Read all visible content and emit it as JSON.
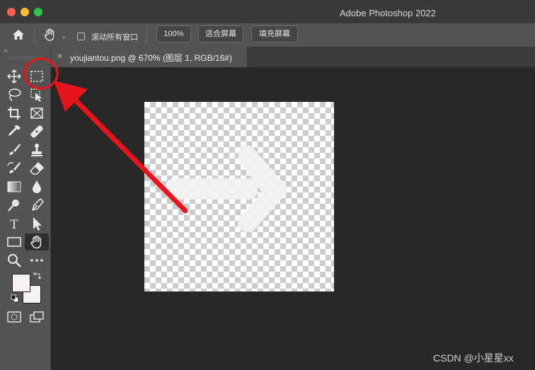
{
  "window": {
    "title": "Adobe Photoshop 2022"
  },
  "options": {
    "scroll_all_windows": "滚动所有窗口",
    "zoom_100": "100%",
    "fit_screen": "适合屏幕",
    "fill_screen": "填充屏幕"
  },
  "document_tab": {
    "close": "×",
    "title": "youjiantou.png @ 670% (图层 1, RGB/16#)"
  },
  "toolbar": {
    "collapse": "‹‹",
    "tools": [
      "move-icon",
      "rectangular-marquee-icon",
      "lasso-icon",
      "object-selection-icon",
      "crop-icon",
      "frame-icon",
      "eyedropper-icon",
      "healing-brush-icon",
      "brush-icon",
      "clone-stamp-icon",
      "history-brush-icon",
      "eraser-icon",
      "gradient-icon",
      "blur-icon",
      "dodge-icon",
      "pen-icon",
      "type-icon",
      "path-selection-icon",
      "rectangle-icon",
      "hand-icon",
      "zoom-icon",
      "more-tools-icon"
    ],
    "type_glyph": "T",
    "foreground_color": "#f7f2f2",
    "background_color": "#f7f2f2"
  },
  "annotation_color": "#e8141b",
  "watermark": "CSDN @小星星xx"
}
